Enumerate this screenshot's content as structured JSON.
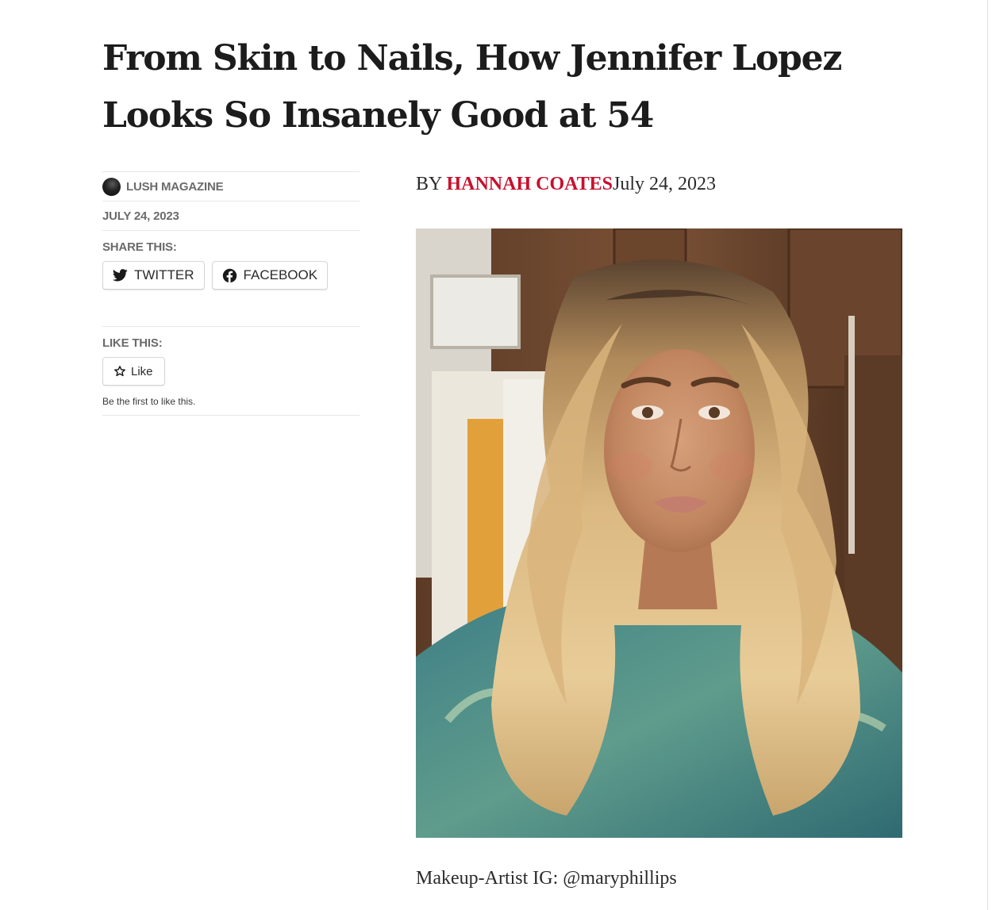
{
  "article": {
    "title": "From Skin to Nails, How Jennifer Lopez Looks So Insanely Good at 54"
  },
  "meta": {
    "publication": "LUSH MAGAZINE",
    "date": "JULY 24, 2023"
  },
  "share": {
    "label": "SHARE THIS:",
    "twitter_label": "TWITTER",
    "facebook_label": "FACEBOOK"
  },
  "like": {
    "label": "LIKE THIS:",
    "button_label": "Like",
    "note": "Be the first to like this."
  },
  "byline": {
    "prefix": "BY ",
    "author": "HANNAH COATES",
    "date": "July 24, 2023"
  },
  "caption": "Makeup-Artist IG: @maryphillips",
  "colors": {
    "author_link": "#c8102e",
    "meta_gray": "#6b6b6b"
  },
  "icons": {
    "twitter": "twitter-bird-icon",
    "facebook": "facebook-circle-icon",
    "like": "star-outline-icon"
  }
}
